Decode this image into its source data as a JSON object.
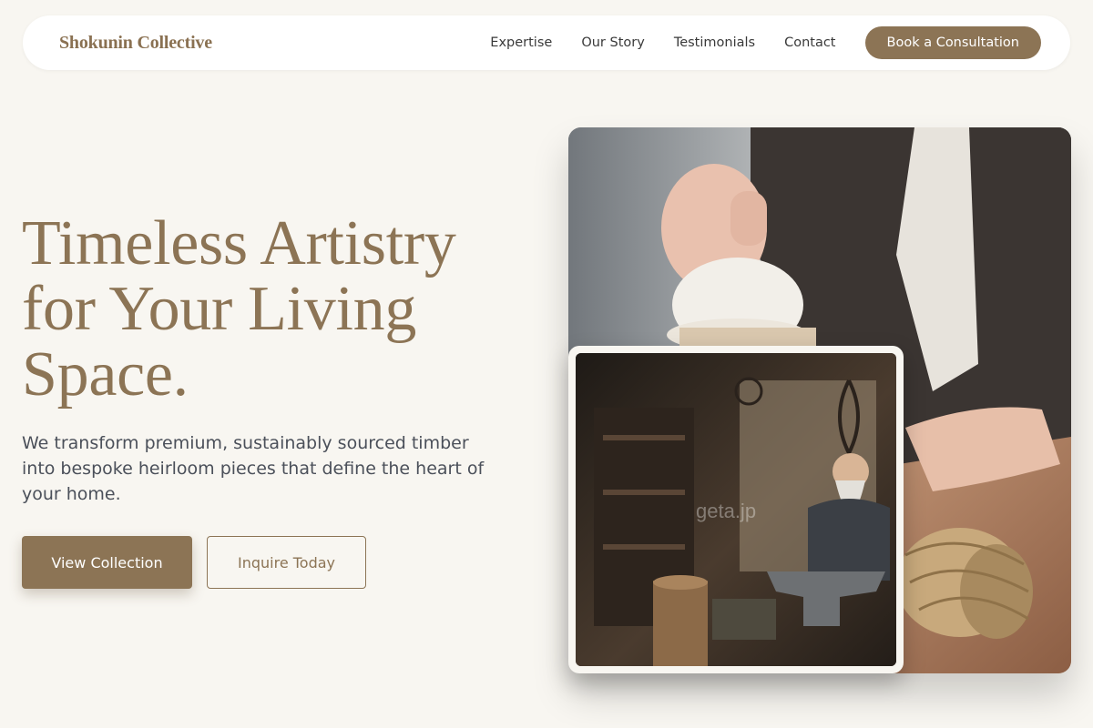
{
  "nav": {
    "brand": "Shokunin Collective",
    "links": [
      "Expertise",
      "Our Story",
      "Testimonials",
      "Contact"
    ],
    "cta": "Book a Consultation"
  },
  "hero": {
    "title": "Timeless Artistry for Your Living Space.",
    "subtitle": "We transform premium, sustainably sourced timber into bespoke heirloom pieces that define the heart of your home.",
    "primary_button": "View Collection",
    "secondary_button": "Inquire Today"
  },
  "images": {
    "main_alt": "Artisan lifting ceramic jar lid beside twine spool",
    "inset_alt": "Blacksmith working at anvil in workshop",
    "inset_watermark": "geta.jp"
  },
  "colors": {
    "accent": "#8c7455",
    "background": "#f8f6f1",
    "text": "#4b505a"
  }
}
